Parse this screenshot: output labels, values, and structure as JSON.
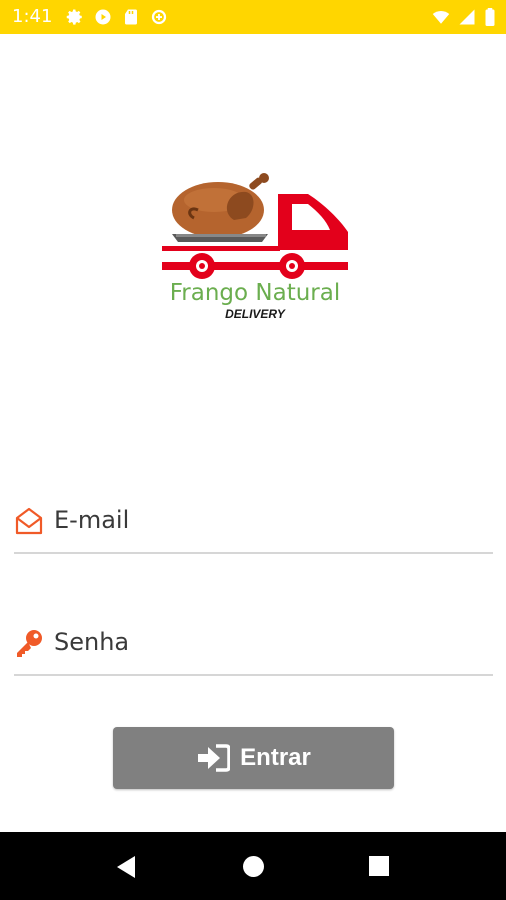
{
  "status_bar": {
    "time": "1:41",
    "background_color": "#FFD600",
    "left_icons": [
      "gear-icon",
      "play-icon",
      "sd-card-icon",
      "data-saver-icon"
    ],
    "right_icons": [
      "wifi-icon",
      "signal-icon",
      "battery-icon"
    ]
  },
  "logo": {
    "brand_name": "Frango Natural",
    "tagline": "DELIVERY",
    "colors": {
      "brand_green": "#6BAE4F",
      "truck_red": "#E3001B",
      "chicken_brown": "#B5642E"
    }
  },
  "form": {
    "email": {
      "placeholder": "E-mail",
      "icon": "envelope-open-icon"
    },
    "password": {
      "placeholder": "Senha",
      "icon": "key-icon"
    },
    "icon_color": "#F05A28",
    "submit": {
      "label": "Entrar",
      "icon": "sign-in-icon"
    }
  },
  "nav_bar": {
    "buttons": [
      "back",
      "home",
      "recents"
    ]
  }
}
